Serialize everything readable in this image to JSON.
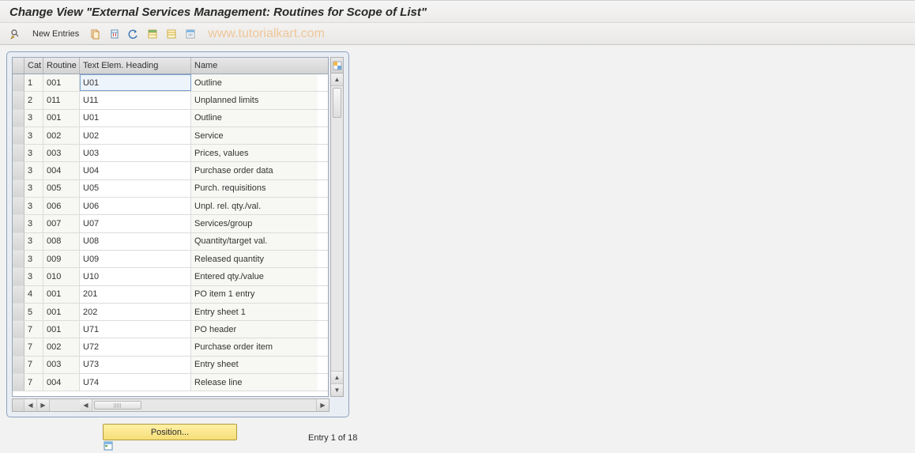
{
  "title": "Change View \"External Services Management: Routines for Scope of List\"",
  "toolbar": {
    "new_entries_label": "New Entries"
  },
  "watermark": "www.tutorialkart.com",
  "table": {
    "columns": {
      "cat": "Cat",
      "routine": "Routine",
      "text": "Text Elem. Heading",
      "name": "Name"
    },
    "rows": [
      {
        "cat": "1",
        "routine": "001",
        "text": "U01",
        "name": "Outline"
      },
      {
        "cat": "2",
        "routine": "011",
        "text": "U11",
        "name": "Unplanned limits"
      },
      {
        "cat": "3",
        "routine": "001",
        "text": "U01",
        "name": "Outline"
      },
      {
        "cat": "3",
        "routine": "002",
        "text": "U02",
        "name": "Service"
      },
      {
        "cat": "3",
        "routine": "003",
        "text": "U03",
        "name": "Prices, values"
      },
      {
        "cat": "3",
        "routine": "004",
        "text": "U04",
        "name": "Purchase order data"
      },
      {
        "cat": "3",
        "routine": "005",
        "text": "U05",
        "name": "Purch. requisitions"
      },
      {
        "cat": "3",
        "routine": "006",
        "text": "U06",
        "name": "Unpl. rel. qty./val."
      },
      {
        "cat": "3",
        "routine": "007",
        "text": "U07",
        "name": "Services/group"
      },
      {
        "cat": "3",
        "routine": "008",
        "text": "U08",
        "name": "Quantity/target val."
      },
      {
        "cat": "3",
        "routine": "009",
        "text": "U09",
        "name": "Released quantity"
      },
      {
        "cat": "3",
        "routine": "010",
        "text": "U10",
        "name": "Entered qty./value"
      },
      {
        "cat": "4",
        "routine": "001",
        "text": "201",
        "name": "PO item 1 entry"
      },
      {
        "cat": "5",
        "routine": "001",
        "text": "202",
        "name": "Entry sheet 1"
      },
      {
        "cat": "7",
        "routine": "001",
        "text": "U71",
        "name": "PO header"
      },
      {
        "cat": "7",
        "routine": "002",
        "text": "U72",
        "name": "Purchase order item"
      },
      {
        "cat": "7",
        "routine": "003",
        "text": "U73",
        "name": "Entry sheet"
      },
      {
        "cat": "7",
        "routine": "004",
        "text": "U74",
        "name": "Release line"
      }
    ],
    "active_cell": {
      "row": 0,
      "col": "text"
    }
  },
  "footer": {
    "position_label": "Position...",
    "entry_status": "Entry 1 of 18"
  }
}
